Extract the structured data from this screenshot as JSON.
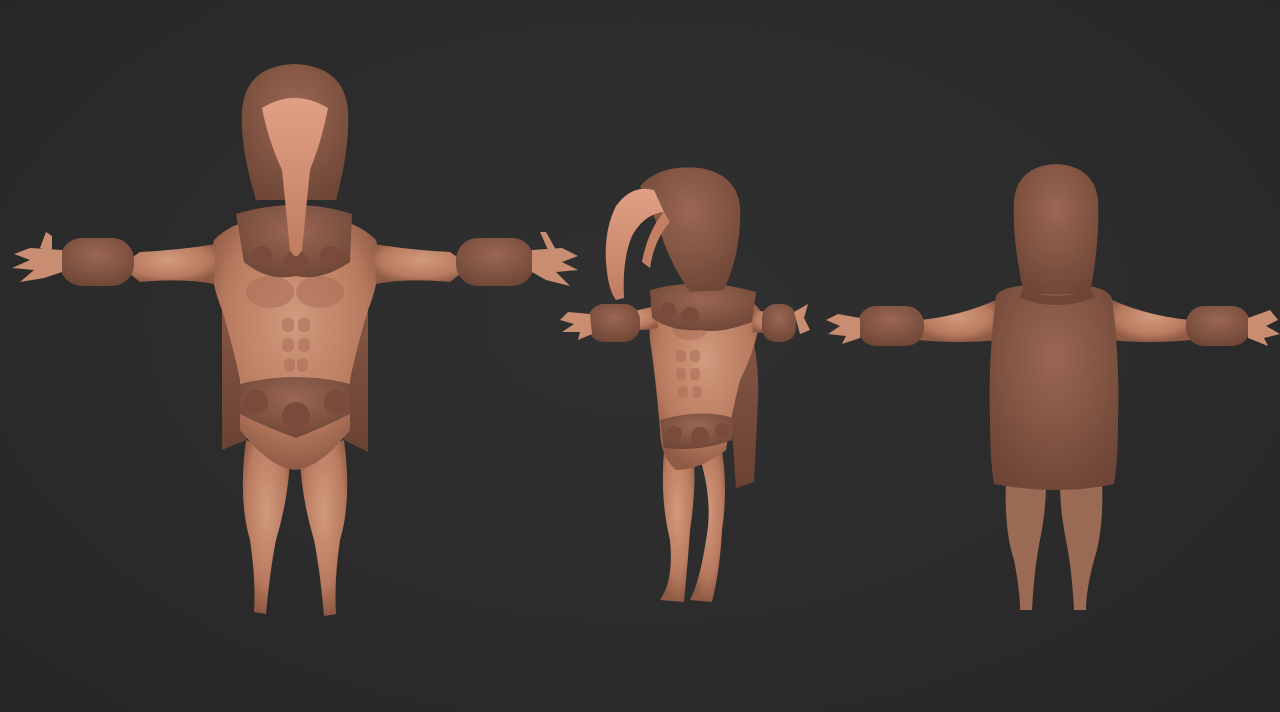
{
  "scene": {
    "subject": "",
    "background_color": "#2c2c2c",
    "colors": {
      "skin_light": "#c98e72",
      "skin_mid": "#b87a5e",
      "skin_dark": "#8f5b45",
      "armor": "#8a5a48",
      "armor_dark": "#6e4536",
      "beak": "#d6957a"
    },
    "views": [
      {
        "view": "front"
      },
      {
        "view": "three-quarter"
      },
      {
        "view": "back"
      }
    ]
  }
}
